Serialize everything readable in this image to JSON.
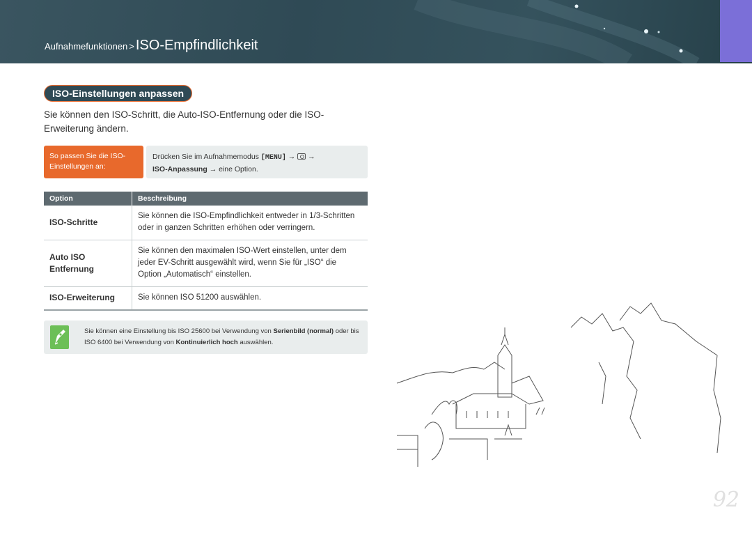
{
  "breadcrumb": {
    "parent": "Aufnahmefunktionen",
    "separator": ">",
    "current": "ISO-Empfindlichkeit"
  },
  "section": {
    "title": "ISO-Einstellungen anpassen",
    "intro": "Sie können den ISO-Schritt, die Auto-ISO-Entfernung oder die ISO-Erweiterung ändern."
  },
  "howto": {
    "label": "So passen Sie die ISO-Einstellungen an:",
    "line1_prefix": "Drücken Sie im Aufnahmemodus",
    "menu_key": "[MENU]",
    "arrow": "→",
    "camera_icon": "camera-icon",
    "line2_bold": "ISO-Anpassung",
    "line2_suffix": "eine Option."
  },
  "table": {
    "headers": [
      "Option",
      "Beschreibung"
    ],
    "rows": [
      {
        "option": "ISO-Schritte",
        "description": "Sie können die ISO-Empfindlichkeit entweder in 1/3-Schritten oder in ganzen Schritten erhöhen oder verringern."
      },
      {
        "option": "Auto ISO Entfernung",
        "description": "Sie können den maximalen ISO-Wert einstellen, unter dem jeder EV-Schritt ausgewählt wird, wenn Sie für „ISO“ die Option „Automatisch“ einstellen."
      },
      {
        "option": "ISO-Erweiterung",
        "description": "Sie können ISO 51200 auswählen."
      }
    ]
  },
  "note": {
    "icon": "pen-nib-icon",
    "part1": "Sie können eine Einstellung bis ISO 25600 bei Verwendung von",
    "bold1": "Serienbild (normal)",
    "part2": "oder bis ISO 6400 bei Verwendung von",
    "bold2": "Kontinuierlich hoch",
    "part3": "auswählen."
  },
  "page_number": "92",
  "colors": {
    "header_bg": "#2f4a55",
    "accent_orange": "#e8692c",
    "accent_purple": "#7b6fd8",
    "note_green": "#6cbf57",
    "table_header": "#5e6a70"
  }
}
